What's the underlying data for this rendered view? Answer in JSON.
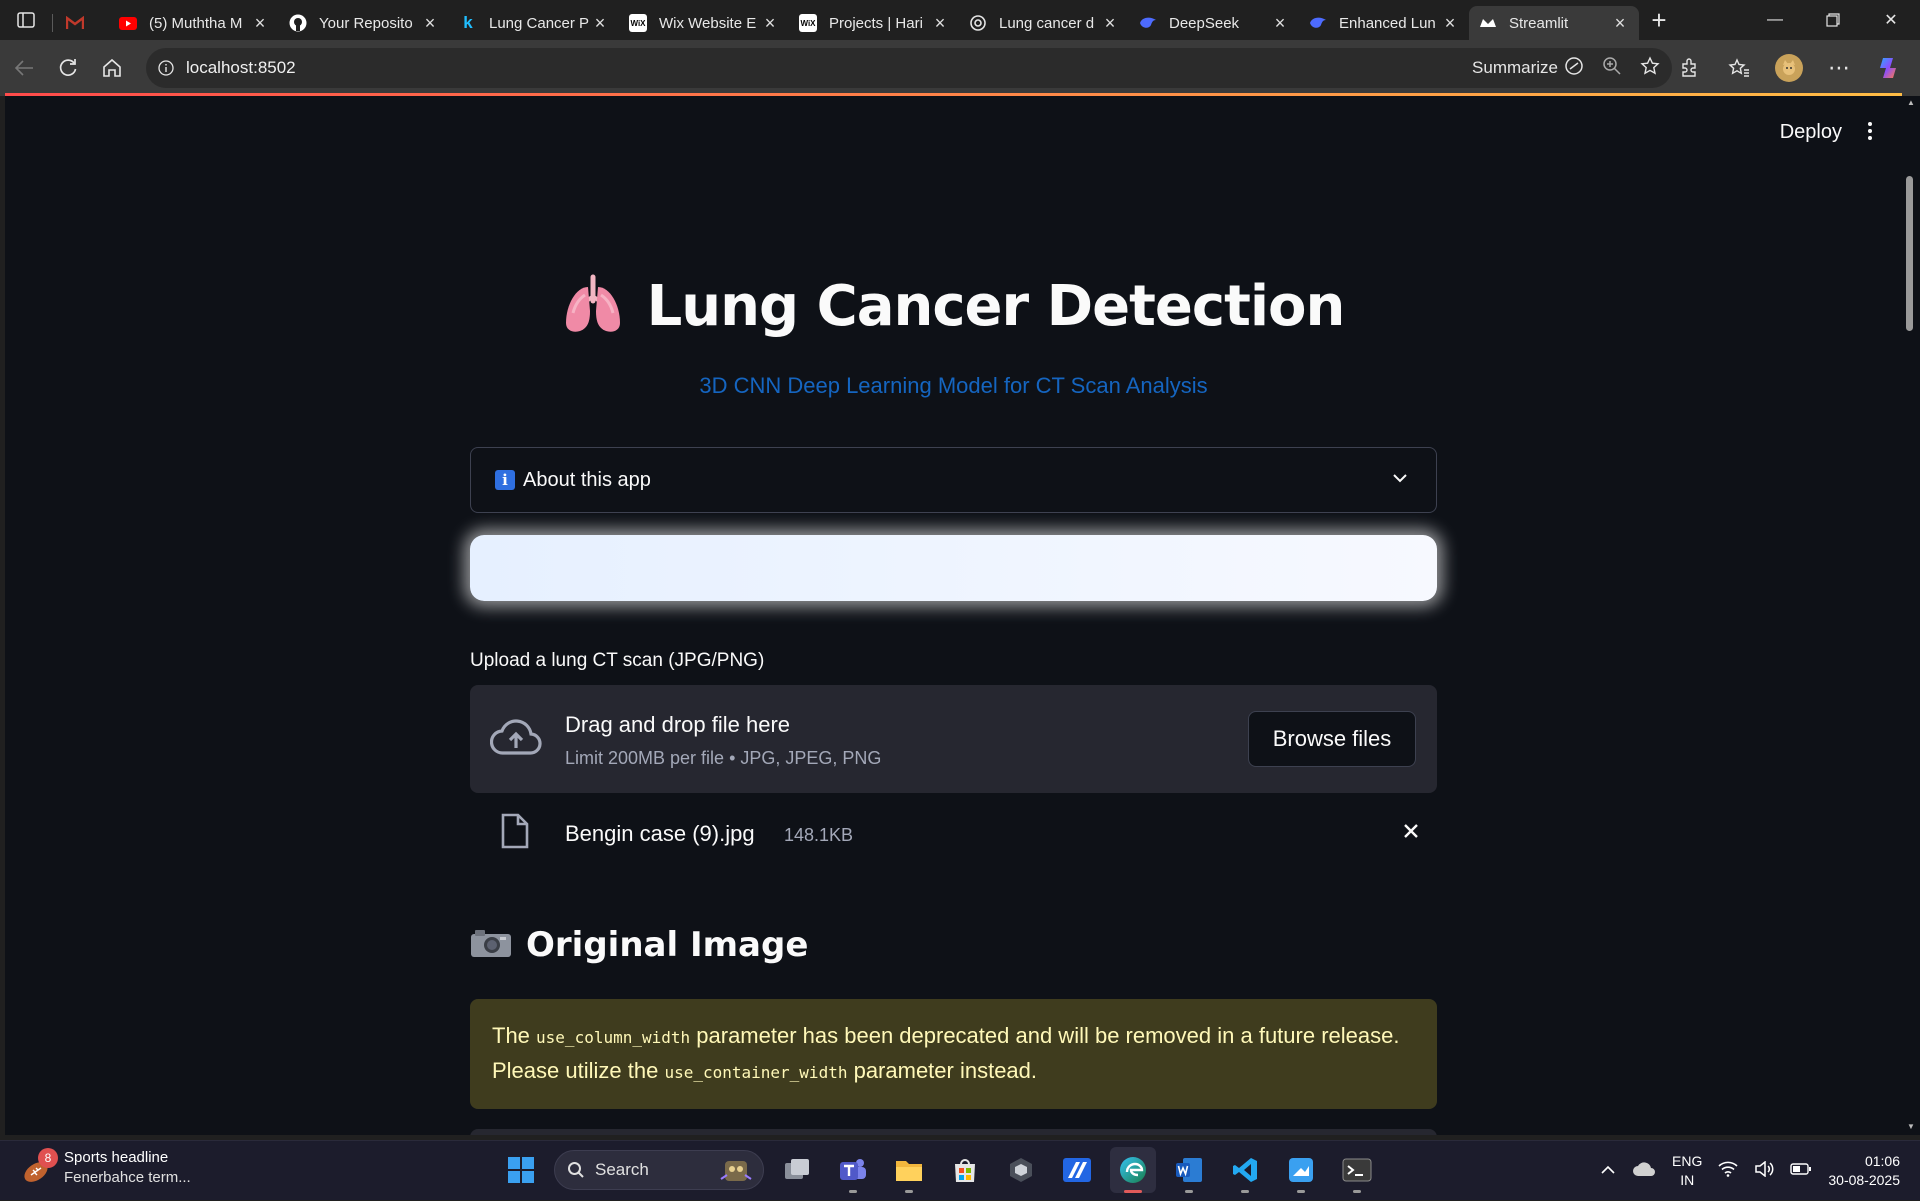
{
  "browser": {
    "tabs": [
      {
        "title": "",
        "favicon": "gmail-icon",
        "color": "#c0392b",
        "pinned": true
      },
      {
        "title": "(5) Muththa M",
        "favicon": "youtube-icon",
        "color": "#ff0000"
      },
      {
        "title": "Your Reposito",
        "favicon": "github-icon",
        "color": "#ffffff"
      },
      {
        "title": "Lung Cancer P",
        "favicon": "kaggle-icon",
        "color": "#20beff"
      },
      {
        "title": "Wix Website E",
        "favicon": "wix-icon",
        "color": "#ffffff"
      },
      {
        "title": "Projects | Hari",
        "favicon": "wix-icon",
        "color": "#ffffff"
      },
      {
        "title": "Lung cancer d",
        "favicon": "chatgpt-icon",
        "color": "#ffffff"
      },
      {
        "title": "DeepSeek",
        "favicon": "deepseek-icon",
        "color": "#4d6bfe"
      },
      {
        "title": "Enhanced Lun",
        "favicon": "deepseek-icon",
        "color": "#4d6bfe"
      },
      {
        "title": "Streamlit",
        "favicon": "streamlit-icon",
        "color": "#ffffff",
        "active": true
      }
    ],
    "url": "localhost:8502",
    "summarize_label": "Summarize"
  },
  "app": {
    "deploy_label": "Deploy",
    "title": "Lung Cancer Detection",
    "title_emoji": "lungs-icon",
    "subtitle": "3D CNN Deep Learning Model for CT Scan Analysis",
    "about_label": "About this app",
    "uploader": {
      "label": "Upload a lung CT scan (JPG/PNG)",
      "drag_text": "Drag and drop file here",
      "limit_text": "Limit 200MB per file • JPG, JPEG, PNG",
      "browse_label": "Browse files"
    },
    "file": {
      "name": "Bengin case (9).jpg",
      "size": "148.1KB"
    },
    "section_title": "Original Image",
    "warning": {
      "part1": "The ",
      "code1": "use_column_width",
      "part2": " parameter has been deprecated and will be removed in a future release. Please utilize the ",
      "code2": "use_container_width",
      "part3": " parameter instead."
    }
  },
  "taskbar": {
    "news_badge": "8",
    "news_headline": "Sports headline",
    "news_sub": "Fenerbahce term...",
    "search_label": "Search",
    "lang_line1": "ENG",
    "lang_line2": "IN",
    "time": "01:06",
    "date": "30-08-2025"
  },
  "colors": {
    "page_bg": "#0e1117",
    "subtitle": "#1565c0",
    "warning_bg": "#3f3c1e",
    "warning_text": "#fff8b8",
    "accent": "#ff4b4b"
  }
}
